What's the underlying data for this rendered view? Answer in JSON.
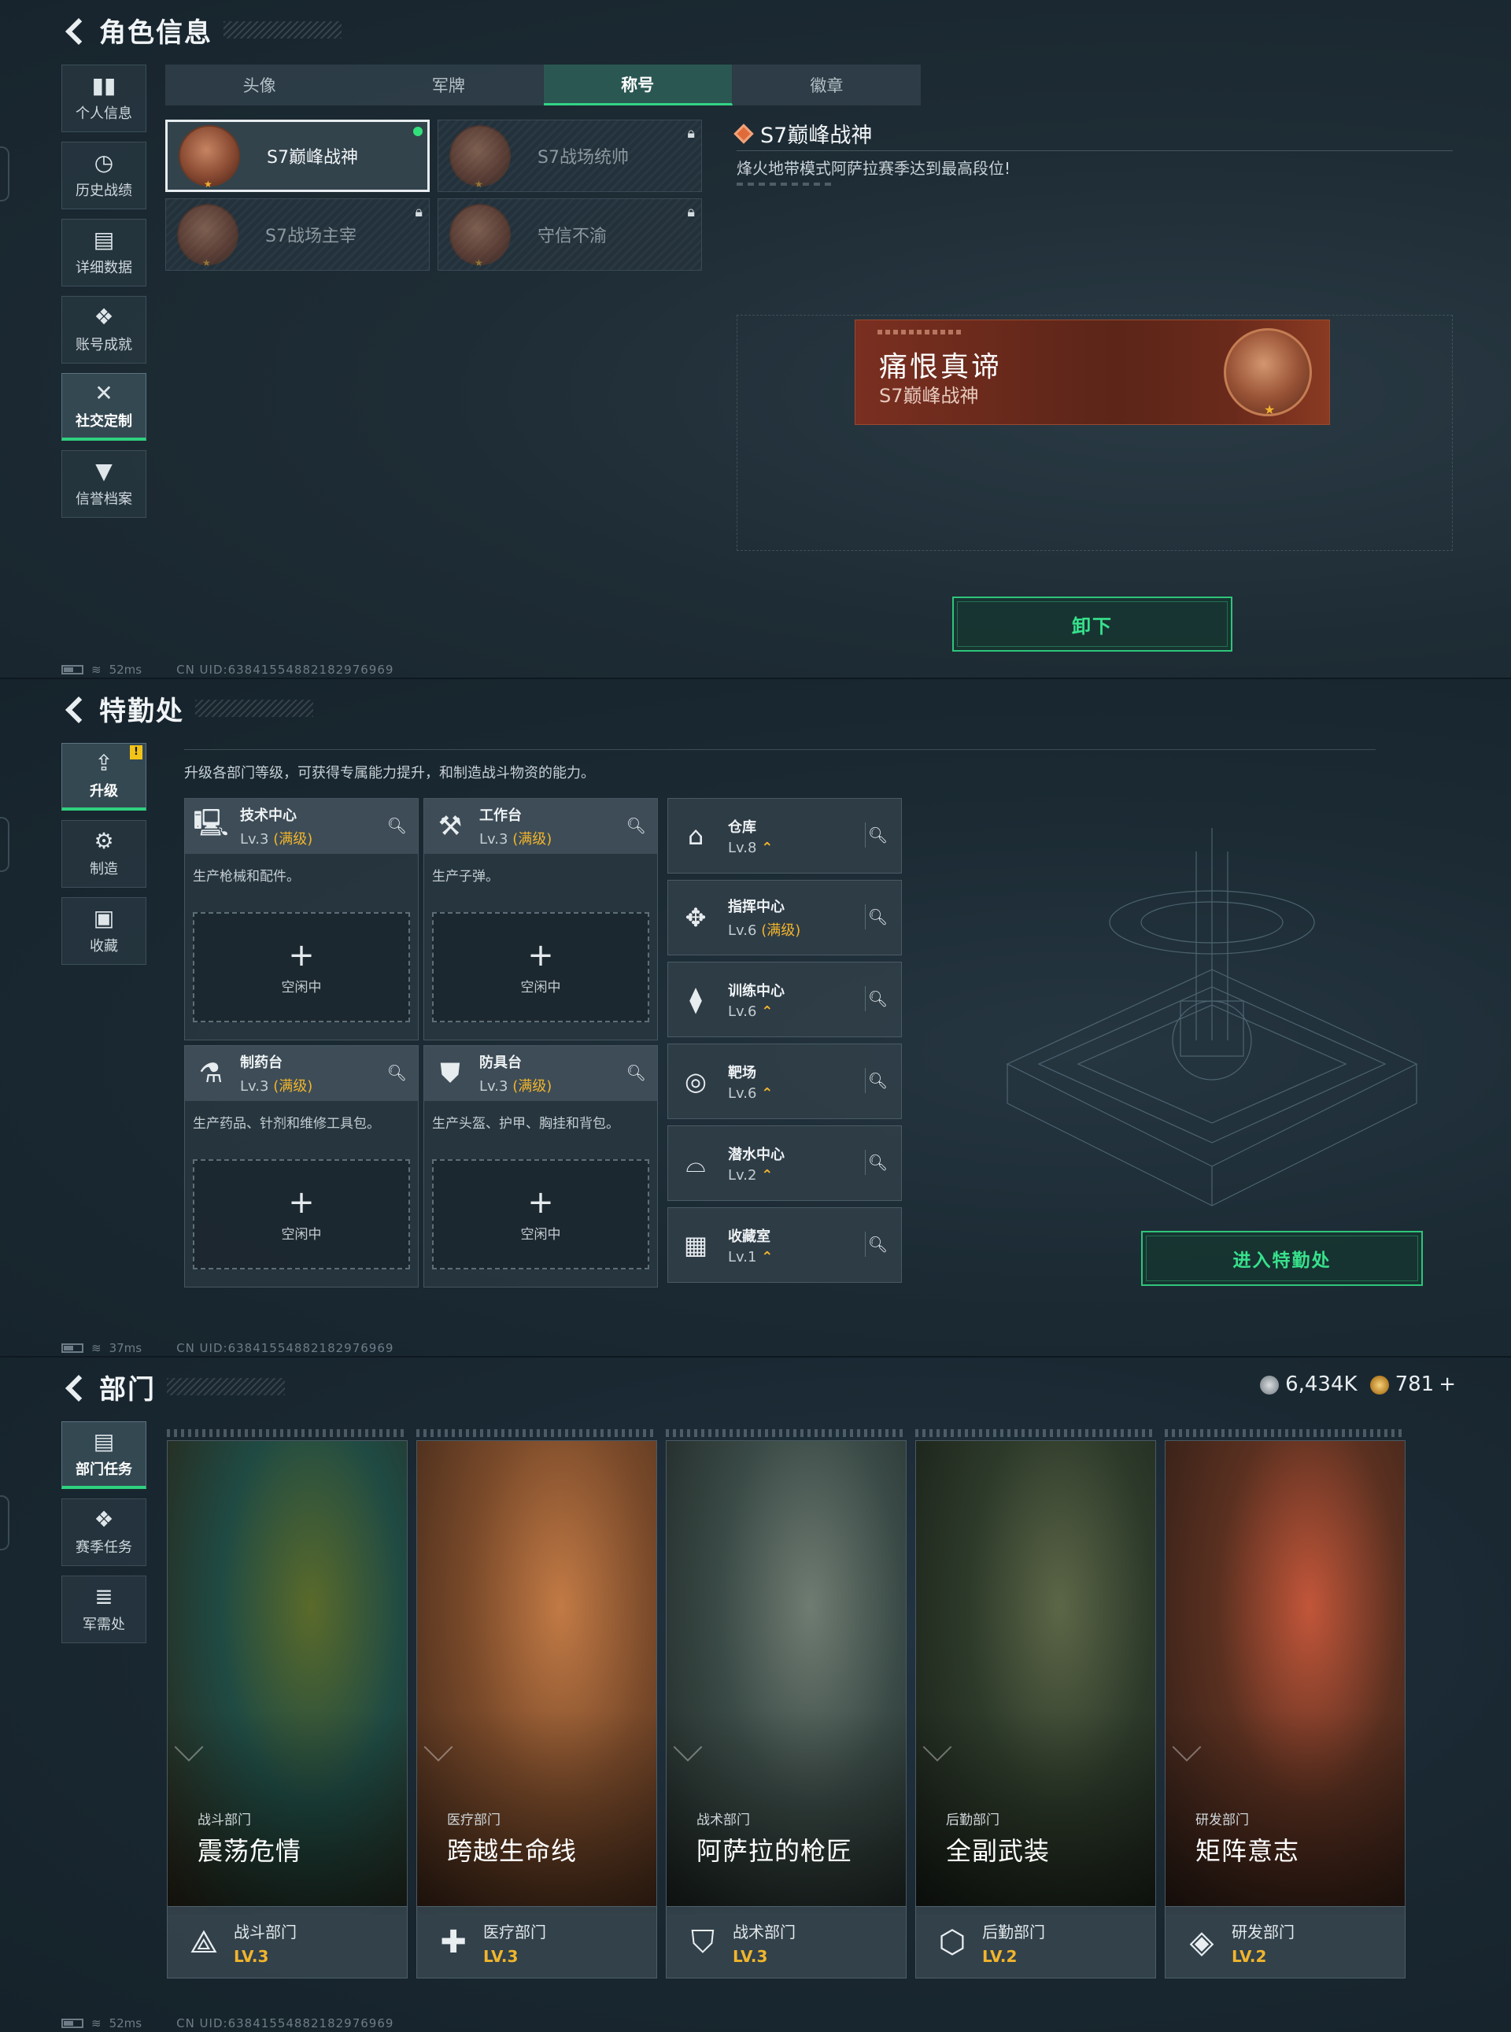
{
  "panel1": {
    "title": "角色信息",
    "nav": [
      {
        "label": "个人信息",
        "icon": "bar-chart-icon"
      },
      {
        "label": "历史战绩",
        "icon": "history-icon"
      },
      {
        "label": "详细数据",
        "icon": "folder-icon"
      },
      {
        "label": "账号成就",
        "icon": "achievement-icon"
      },
      {
        "label": "社交定制",
        "icon": "tools-icon"
      },
      {
        "label": "信誉档案",
        "icon": "reputation-icon"
      }
    ],
    "active_nav": "社交定制",
    "tabs": [
      "头像",
      "军牌",
      "称号",
      "徽章"
    ],
    "active_tab": "称号",
    "titles": [
      {
        "name": "S7巅峰战神",
        "state": "equipped"
      },
      {
        "name": "S7战场统帅",
        "state": "locked"
      },
      {
        "name": "S7战场主宰",
        "state": "locked"
      },
      {
        "name": "守信不渝",
        "state": "locked"
      }
    ],
    "detail": {
      "name": "S7巅峰战神",
      "description": "烽火地带模式阿萨拉赛季达到最高段位!"
    },
    "nameplate": {
      "player_name": "痛恨真谛",
      "title": "S7巅峰战神"
    },
    "unequip_button": "卸下",
    "status": {
      "ping": "52ms",
      "uid": "CN UID:6384155488218297696​9"
    }
  },
  "panel2": {
    "title": "特勤处",
    "nav": [
      {
        "label": "升级",
        "icon": "upgrade-icon",
        "alert": "!"
      },
      {
        "label": "制造",
        "icon": "gear-icon"
      },
      {
        "label": "收藏",
        "icon": "collection-icon"
      }
    ],
    "active_nav": "升级",
    "hint": "升级各部门等级，可获得专属能力提升，和制造战斗物资的能力。",
    "workshops": [
      {
        "name": "技术中心",
        "level": "Lv.3",
        "max_label": "(满级)",
        "desc": "生产枪械和配件。",
        "slot": "空闲中",
        "icon": "computer-icon"
      },
      {
        "name": "工作台",
        "level": "Lv.3",
        "max_label": "(满级)",
        "desc": "生产子弹。",
        "slot": "空闲中",
        "icon": "hammer-wrench-icon"
      },
      {
        "name": "制药台",
        "level": "Lv.3",
        "max_label": "(满级)",
        "desc": "生产药品、针剂和维修工具包。",
        "slot": "空闲中",
        "icon": "microscope-icon"
      },
      {
        "name": "防具台",
        "level": "Lv.3",
        "max_label": "(满级)",
        "desc": "生产头盔、护甲、胸挂和背包。",
        "slot": "空闲中",
        "icon": "armor-icon"
      }
    ],
    "facilities": [
      {
        "name": "仓库",
        "level": "Lv.8",
        "max_label": "",
        "upgradable": true,
        "icon": "warehouse-icon"
      },
      {
        "name": "指挥中心",
        "level": "Lv.6",
        "max_label": "(满级)",
        "upgradable": false,
        "icon": "command-icon"
      },
      {
        "name": "训练中心",
        "level": "Lv.6",
        "max_label": "",
        "upgradable": true,
        "icon": "dumbbell-icon"
      },
      {
        "name": "靶场",
        "level": "Lv.6",
        "max_label": "",
        "upgradable": true,
        "icon": "target-icon"
      },
      {
        "name": "潜水中心",
        "level": "Lv.2",
        "max_label": "",
        "upgradable": true,
        "icon": "diving-mask-icon"
      },
      {
        "name": "收藏室",
        "level": "Lv.1",
        "max_label": "",
        "upgradable": true,
        "icon": "vault-icon"
      }
    ],
    "enter_button": "进入特勤处",
    "status": {
      "ping": "37ms",
      "uid": "CN UID:6384155488218297696​9"
    }
  },
  "panel3": {
    "title": "部门",
    "currency": {
      "silver": "6,434K",
      "gold": "781"
    },
    "nav": [
      {
        "label": "部门任务",
        "icon": "task-icon"
      },
      {
        "label": "赛季任务",
        "icon": "season-icon"
      },
      {
        "label": "军需处",
        "icon": "coins-icon"
      }
    ],
    "active_nav": "部门任务",
    "departments": [
      {
        "category": "战斗部门",
        "mission": "震荡危情",
        "dept": "战斗部门",
        "level": "LV.3",
        "icon": "combat-dept-icon",
        "colors": [
          "#1f4a43",
          "#5a6a2a",
          "#2a2215"
        ]
      },
      {
        "category": "医疗部门",
        "mission": "跨越生命线",
        "dept": "医疗部门",
        "level": "LV.3",
        "icon": "medical-dept-icon",
        "colors": [
          "#7a4a2a",
          "#c27a45",
          "#3a2418"
        ]
      },
      {
        "category": "战术部门",
        "mission": "阿萨拉的枪匠",
        "dept": "战术部门",
        "level": "LV.3",
        "icon": "tactical-dept-icon",
        "colors": [
          "#3a4a46",
          "#6f7c72",
          "#1c2422"
        ]
      },
      {
        "category": "后勤部门",
        "mission": "全副武装",
        "dept": "后勤部门",
        "level": "LV.2",
        "icon": "logistics-dept-icon",
        "colors": [
          "#2d3a2a",
          "#5c6647",
          "#161c16"
        ]
      },
      {
        "category": "研发部门",
        "mission": "矩阵意志",
        "dept": "研发部门",
        "level": "LV.2",
        "icon": "research-dept-icon",
        "colors": [
          "#5a3020",
          "#c2563a",
          "#2a1c16"
        ]
      }
    ],
    "status": {
      "ping": "52ms",
      "uid": "CN UID:6384155488218297696​9"
    }
  }
}
